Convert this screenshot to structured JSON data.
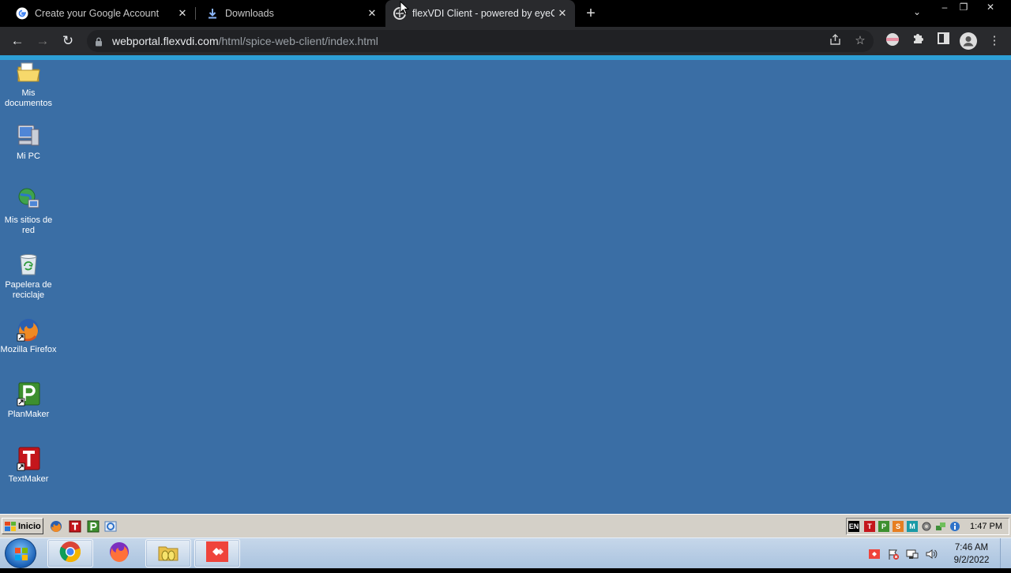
{
  "browser": {
    "tabs": [
      {
        "title": "Create your Google Account",
        "icon": "google-icon",
        "active": false
      },
      {
        "title": "Downloads",
        "icon": "download-icon",
        "active": false
      },
      {
        "title": "flexVDI Client - powered by eyeC",
        "icon": "flexvdi-icon",
        "active": true
      }
    ],
    "tab_close_glyph": "✕",
    "new_tab_glyph": "+",
    "tab_search_glyph": "⌄",
    "window_controls": {
      "minimize": "–",
      "restore": "❐",
      "close": "✕"
    },
    "url_host": "webportal.flexvdi.com",
    "url_path": "/html/spice-web-client/index.html",
    "nav": {
      "back": "←",
      "forward": "→",
      "reload": "↻"
    },
    "accent_color": "#2d9fd6"
  },
  "desktop": {
    "background_color": "#3a6ea5",
    "icons": [
      {
        "label": "Mis documentos",
        "icon": "folder-documents-icon"
      },
      {
        "label": "Mi PC",
        "icon": "computer-icon"
      },
      {
        "label": "Mis sitios de red",
        "icon": "network-places-icon"
      },
      {
        "label": "Papelera de reciclaje",
        "icon": "recycle-bin-icon"
      },
      {
        "label": "Mozilla Firefox",
        "icon": "firefox-icon"
      },
      {
        "label": "PlanMaker",
        "icon": "planmaker-icon"
      },
      {
        "label": "TextMaker",
        "icon": "textmaker-icon"
      }
    ]
  },
  "remote_taskbar": {
    "start_label": "Inicio",
    "tray_language": "EN",
    "tray_letters": [
      "T",
      "P",
      "S",
      "M"
    ],
    "time": "1:47 PM"
  },
  "host_taskbar": {
    "pinned": [
      "chrome-icon",
      "firefox-icon",
      "explorer-icon",
      "anydesk-icon"
    ],
    "time": "7:46 AM",
    "date": "9/2/2022"
  }
}
